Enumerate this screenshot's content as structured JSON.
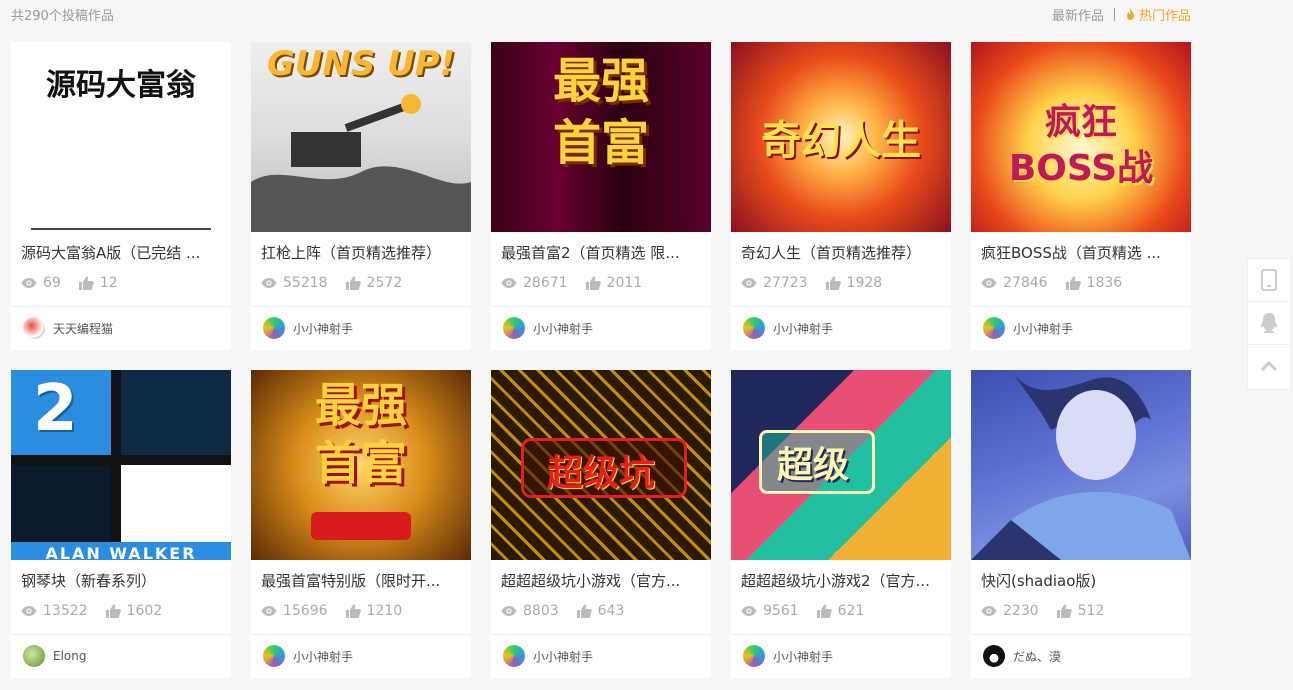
{
  "header": {
    "count_text": "共290个投稿作品",
    "sort_latest": "最新作品",
    "sort_hot": "热门作品"
  },
  "colors": {
    "accent": "#f5a623",
    "muted": "#999999"
  },
  "cards": [
    {
      "title": "源码大富翁A版（已完结 ...",
      "views": "69",
      "likes": "12",
      "author": "天天编程猫",
      "thumb_text": "源码大富翁"
    },
    {
      "title": "扛枪上阵（首页精选推荐）",
      "views": "55218",
      "likes": "2572",
      "author": "小小神射手",
      "thumb_text": "GUNS UP!"
    },
    {
      "title": "最强首富2（首页精选 限...",
      "views": "28671",
      "likes": "2011",
      "author": "小小神射手",
      "thumb_text": "最强首富"
    },
    {
      "title": "奇幻人生（首页精选推荐）",
      "views": "27723",
      "likes": "1928",
      "author": "小小神射手",
      "thumb_text": "奇幻人生"
    },
    {
      "title": "疯狂BOSS战（首页精选 ...",
      "views": "27846",
      "likes": "1836",
      "author": "小小神射手",
      "thumb_text": "疯狂BOSS战"
    },
    {
      "title": "钢琴块（新春系列）",
      "views": "13522",
      "likes": "1602",
      "author": "Elong",
      "thumb_text": "ALAN WALKER"
    },
    {
      "title": "最强首富特别版（限时开...",
      "views": "15696",
      "likes": "1210",
      "author": "小小神射手",
      "thumb_text": "最强首富"
    },
    {
      "title": "超超超级坑小游戏（官方...",
      "views": "8803",
      "likes": "643",
      "author": "小小神射手",
      "thumb_text": "超级坑"
    },
    {
      "title": "超超超级坑小游戏2（官方...",
      "views": "9561",
      "likes": "621",
      "author": "小小神射手",
      "thumb_text": "超级"
    },
    {
      "title": "快闪(shadiao版)",
      "views": "2230",
      "likes": "512",
      "author": "だぬ、漠",
      "thumb_text": ""
    }
  ],
  "sidebar": {
    "icons": [
      "phone-icon",
      "qq-icon",
      "back-to-top-icon"
    ]
  }
}
